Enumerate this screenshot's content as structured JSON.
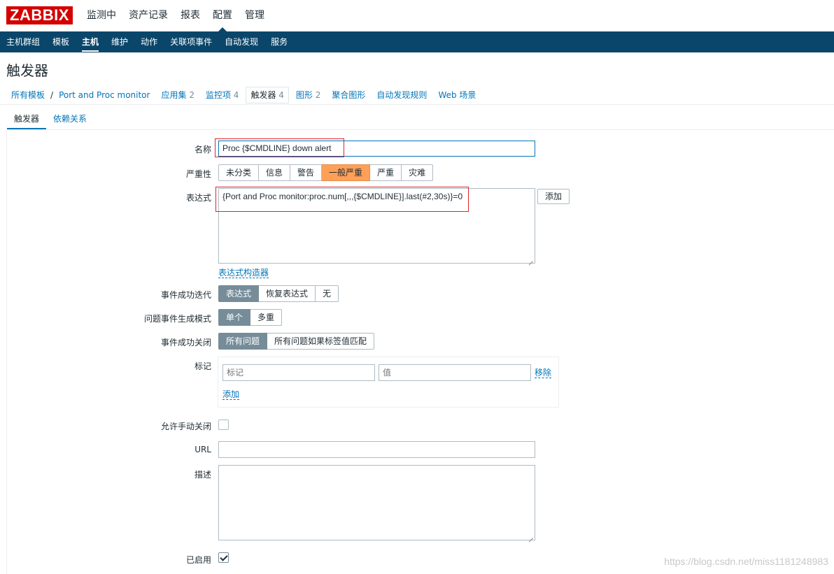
{
  "app": {
    "logo": "ZABBIX",
    "top_menu": [
      "监测中",
      "资产记录",
      "报表",
      "配置",
      "管理"
    ],
    "top_menu_active": "配置",
    "sub_menu": [
      "主机群组",
      "模板",
      "主机",
      "维护",
      "动作",
      "关联项事件",
      "自动发现",
      "服务"
    ],
    "sub_menu_active": "主机"
  },
  "page": {
    "title": "触发器"
  },
  "breadcrumb": {
    "all_templates": "所有模板",
    "separator": "/",
    "template": "Port and Proc monitor",
    "items": [
      {
        "label": "应用集",
        "count": "2"
      },
      {
        "label": "监控项",
        "count": "4"
      },
      {
        "label": "触发器",
        "count": "4"
      },
      {
        "label": "图形",
        "count": "2"
      },
      {
        "label": "聚合图形",
        "count": ""
      },
      {
        "label": "自动发现规则",
        "count": ""
      },
      {
        "label": "Web 场景",
        "count": ""
      }
    ]
  },
  "tabs": [
    "触发器",
    "依赖关系"
  ],
  "form": {
    "name_label": "名称",
    "name_value": "Proc {$CMDLINE} down alert",
    "severity_label": "严重性",
    "severity_options": [
      "未分类",
      "信息",
      "警告",
      "一般严重",
      "严重",
      "灾难"
    ],
    "severity_selected": "一般严重",
    "expression_label": "表达式",
    "expression_value": "{Port and Proc monitor:proc.num[,,,{$CMDLINE}].last(#2,30s)}=0",
    "expression_add_button": "添加",
    "expression_builder_link": "表达式构造器",
    "ok_event_label": "事件成功迭代",
    "ok_event_options": [
      "表达式",
      "恢复表达式",
      "无"
    ],
    "ok_event_selected": "表达式",
    "problem_mode_label": "问题事件生成模式",
    "problem_mode_options": [
      "单个",
      "多重"
    ],
    "problem_mode_selected": "单个",
    "ok_close_label": "事件成功关闭",
    "ok_close_options": [
      "所有问题",
      "所有问题如果标签值匹配"
    ],
    "ok_close_selected": "所有问题",
    "tags_label": "标记",
    "tag_placeholder": "标记",
    "value_placeholder": "值",
    "tag_remove_link": "移除",
    "tag_add_link": "添加",
    "manual_close_label": "允许手动关闭",
    "manual_close_checked": false,
    "url_label": "URL",
    "url_value": "",
    "description_label": "描述",
    "description_value": "",
    "enabled_label": "已启用",
    "enabled_checked": true
  },
  "watermark": "https://blog.csdn.net/miss1181248983",
  "colors": {
    "header_bg": "#0a466a",
    "logo_bg": "#d40000",
    "link": "#0275b8",
    "severity_average": "#ffa059",
    "selected_segment": "#768d99",
    "highlight_box": "#e0242a"
  }
}
